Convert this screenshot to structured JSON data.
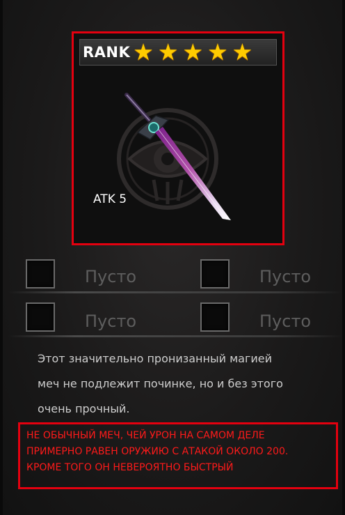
{
  "item": {
    "rank_label": "RANK",
    "stars": [
      "★",
      "★",
      "★",
      "★",
      "★"
    ],
    "stat_label": "ATK 5",
    "icon": "sword-icon",
    "rank_stars": 5
  },
  "slots": [
    {
      "label": "Пусто"
    },
    {
      "label": "Пусто"
    },
    {
      "label": "Пусто"
    },
    {
      "label": "Пусто"
    }
  ],
  "description": {
    "line1": "Этот значительно пронизанный магией",
    "line2": "меч не подлежит починке, но и без этого",
    "line3": "очень прочный."
  },
  "annotation": {
    "line1": "НЕ ОБЫЧНЫЙ МЕЧ, ЧЕЙ УРОН НА САМОМ ДЕЛЕ",
    "line2": "ПРИМЕРНО РАВЕН ОРУЖИЮ С АТАКОЙ ОКОЛО 200.",
    "line3": "КРОМЕ ТОГО ОН НЕВЕРОЯТНО БЫСТРЫЙ"
  },
  "colors": {
    "highlight_border": "#e4000f",
    "annotation_text": "#ff1a1a",
    "star": "#ffcc00"
  }
}
